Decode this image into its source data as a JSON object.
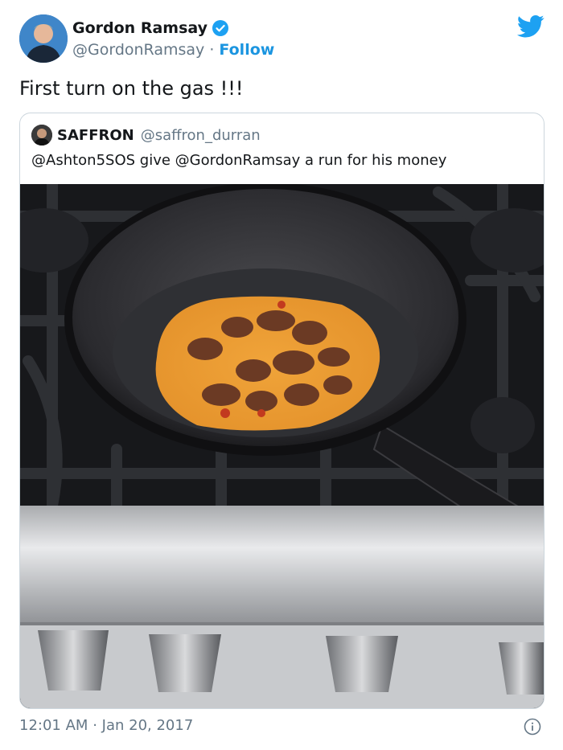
{
  "author": {
    "name": "Gordon Ramsay",
    "handle": "@GordonRamsay",
    "separator": "·",
    "follow_label": "Follow",
    "verified_icon": "verified-badge-icon",
    "avatar_icon": "avatar-photo"
  },
  "brand": {
    "logo_icon": "twitter-bird-icon",
    "accent": "#1da1f2",
    "link_color": "#1b95e0"
  },
  "tweet": {
    "text": "First turn on the gas !!!"
  },
  "quoted_tweet": {
    "name": "SAFFRON",
    "handle": "@saffron_durran",
    "text": "@Ashton5SOS give @GordonRamsay a run for his money",
    "media_icon": "omelette-in-pan-photo"
  },
  "footer": {
    "time": "12:01 AM",
    "separator": "·",
    "date": "Jan 20, 2017",
    "info_icon": "info-icon"
  }
}
